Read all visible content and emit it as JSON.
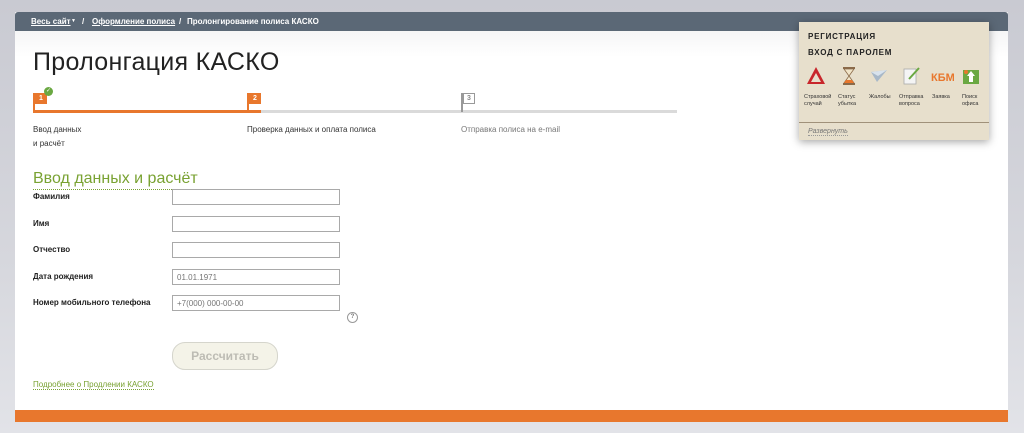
{
  "breadcrumb": {
    "all_site": "Весь сайт",
    "all_site_arrow": "▼",
    "sep1": "/",
    "policy": "Оформление полиса",
    "sep2": "/",
    "current": "Пролонгирование полиса КАСКО"
  },
  "page_title": "Пролонгация КАСКО",
  "stepper": {
    "steps": [
      {
        "number": "1",
        "label_line1": "Ввод данных",
        "label_line2": "и расчёт",
        "state": "done"
      },
      {
        "number": "2",
        "label": "Проверка данных и оплата полиса",
        "state": "active"
      },
      {
        "number": "3",
        "label": "Отправка полиса на e-mail",
        "state": "pending"
      }
    ],
    "done_check": "✓"
  },
  "section_title": "Ввод данных и расчёт",
  "form": {
    "last_name": {
      "label": "Фамилия",
      "value": "",
      "placeholder": ""
    },
    "first_name": {
      "label": "Имя",
      "value": "",
      "placeholder": ""
    },
    "patronymic": {
      "label": "Отчество",
      "value": "",
      "placeholder": ""
    },
    "birth_date": {
      "label": "Дата рождения",
      "value": "",
      "placeholder": "01.01.1971"
    },
    "phone": {
      "label": "Номер мобильного телефона",
      "value": "",
      "placeholder": "+7(000) 000-00-00"
    },
    "help_glyph": "?"
  },
  "calc_button": "Рассчитать",
  "more_link": "Подробнее о Продлении КАСКО",
  "widget": {
    "registration": "РЕГИСТРАЦИЯ",
    "login": "ВХОД С ПАРОЛЕМ",
    "items": [
      {
        "icon": "warning-triangle-icon",
        "line1": "Страховой",
        "line2": "случай"
      },
      {
        "icon": "hourglass-icon",
        "line1": "Статус",
        "line2": "убытка"
      },
      {
        "icon": "paper-plane-icon",
        "line1": "Жалобы",
        "line2": ""
      },
      {
        "icon": "pen-document-icon",
        "line1": "Отправка",
        "line2": "вопроса"
      },
      {
        "icon": "kbm-logo-icon",
        "line1": "Заявка",
        "line2": "",
        "logo_text": "КБМ"
      },
      {
        "icon": "office-location-icon",
        "line1": "Поиск",
        "line2": "офиса"
      }
    ],
    "expand": "Развернуть"
  },
  "colors": {
    "accent_orange": "#e8772d",
    "accent_green": "#79a232",
    "topbar": "#5b6876",
    "widget_bg": "#e7dfcc"
  }
}
